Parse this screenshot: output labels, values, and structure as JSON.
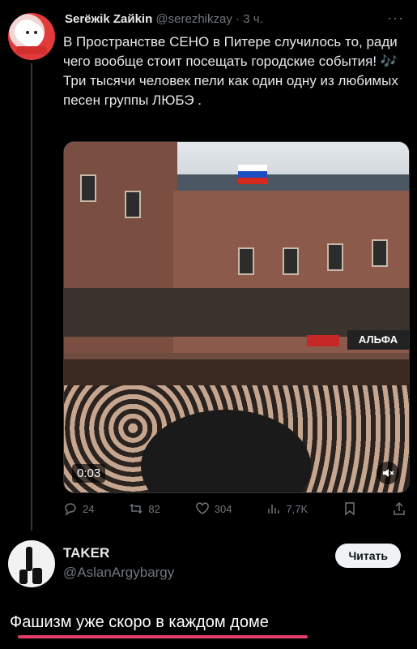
{
  "tweet": {
    "author_name": "Serёжik Zaйkin",
    "author_handle": "@serezhikzay",
    "time": "· 3 ч.",
    "more": "···",
    "text_lines": [
      "В Пространстве СЕНО в Питере случилось то, ради чего вообще стоит посещать городские события! 🎶",
      "Три тысячи человек пели как один одну из любимых песен группы ЛЮБЭ ."
    ],
    "video_time": "0:03",
    "sign_text": "АЛЬФА"
  },
  "actions": {
    "replies": "24",
    "reposts": "82",
    "likes": "304",
    "views": "7,7K",
    "icons": [
      "reply-icon",
      "repost-icon",
      "like-icon",
      "views-icon",
      "bookmark-icon",
      "share-icon"
    ]
  },
  "reply_user": {
    "name": "TAKER",
    "handle": "@AslanArgybargy",
    "button": "Читать"
  },
  "caption": "Фашизм уже скоро в каждом доме",
  "colors": {
    "background": "#000000",
    "text": "#e7e9ea",
    "muted": "#71767b",
    "underline": "#e63c6b"
  }
}
